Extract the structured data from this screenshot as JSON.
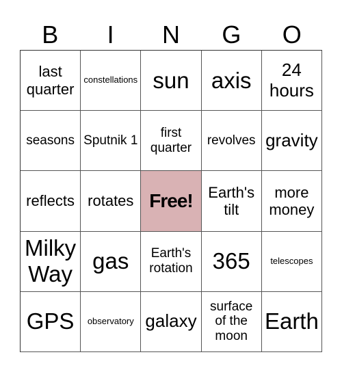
{
  "header": {
    "letters": [
      "B",
      "I",
      "N",
      "G",
      "O"
    ]
  },
  "free_color": "#d9b2b4",
  "cells": [
    {
      "text": "last quarter",
      "size": "md"
    },
    {
      "text": "constellations",
      "size": "xs"
    },
    {
      "text": "sun",
      "size": "xl"
    },
    {
      "text": "axis",
      "size": "xl"
    },
    {
      "text": "24 hours",
      "size": "lg"
    },
    {
      "text": "seasons",
      "size": "sm"
    },
    {
      "text": "Sputnik 1",
      "size": "sm"
    },
    {
      "text": "first quarter",
      "size": "sm"
    },
    {
      "text": "revolves",
      "size": "sm"
    },
    {
      "text": "gravity",
      "size": "lg"
    },
    {
      "text": "reflects",
      "size": "md"
    },
    {
      "text": "rotates",
      "size": "md"
    },
    {
      "text": "Free!",
      "size": "free"
    },
    {
      "text": "Earth's tilt",
      "size": "md"
    },
    {
      "text": "more money",
      "size": "md"
    },
    {
      "text": "Milky Way",
      "size": "xl"
    },
    {
      "text": "gas",
      "size": "xl"
    },
    {
      "text": "Earth's rotation",
      "size": "sm"
    },
    {
      "text": "365",
      "size": "xl"
    },
    {
      "text": "telescopes",
      "size": "xs"
    },
    {
      "text": "GPS",
      "size": "xl"
    },
    {
      "text": "observatory",
      "size": "xs"
    },
    {
      "text": "galaxy",
      "size": "lg"
    },
    {
      "text": "surface of the moon",
      "size": "sm"
    },
    {
      "text": "Earth",
      "size": "xl"
    }
  ]
}
